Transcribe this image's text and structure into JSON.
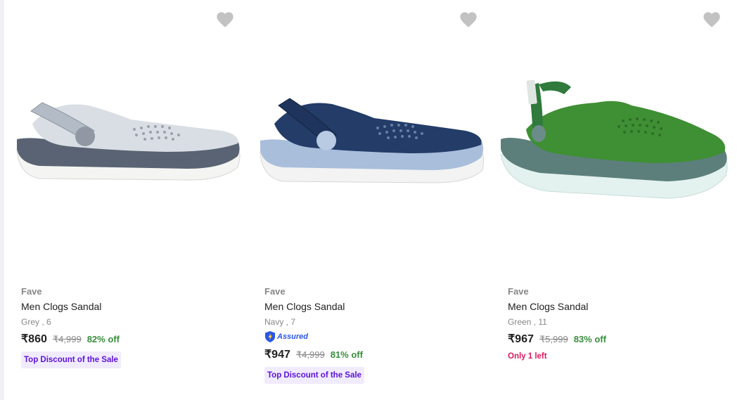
{
  "products": [
    {
      "brand": "Fave",
      "title": "Men Clogs Sandal",
      "variant": "Grey , 6",
      "price": "₹860",
      "mrp": "₹4,999",
      "discount": "82% off",
      "badge": "Top Discount of the Sale",
      "image_icon": "grey-clog-image",
      "colors": {
        "upper": "#d9dee4",
        "sole": "#f4f4f2",
        "band": "#596373",
        "strap": "#b3bcc6"
      }
    },
    {
      "brand": "Fave",
      "title": "Men Clogs Sandal",
      "variant": "Navy , 7",
      "assured": "Assured",
      "price": "₹947",
      "mrp": "₹4,999",
      "discount": "81% off",
      "badge": "Top Discount of the Sale",
      "image_icon": "navy-clog-image",
      "colors": {
        "upper": "#233c68",
        "sole": "#f2f3f2",
        "band": "#a8bedb",
        "strap": "#1f345c"
      }
    },
    {
      "brand": "Fave",
      "title": "Men Clogs Sandal",
      "variant": "Green , 11",
      "price": "₹967",
      "mrp": "₹5,999",
      "discount": "83% off",
      "stock_note": "Only 1 left",
      "image_icon": "green-clog-image",
      "colors": {
        "upper": "#3f8f34",
        "sole": "#e3f2ef",
        "band": "#5c7f7b",
        "strap": "#2f7a3c"
      }
    }
  ],
  "ui_colors": {
    "heart": "#c2c2c2",
    "discount": "#388e3c",
    "badge_bg": "#f1ebff",
    "badge_text": "#5b12d6",
    "stock_text": "#d81b60",
    "assured_blue": "#2a55e5"
  }
}
